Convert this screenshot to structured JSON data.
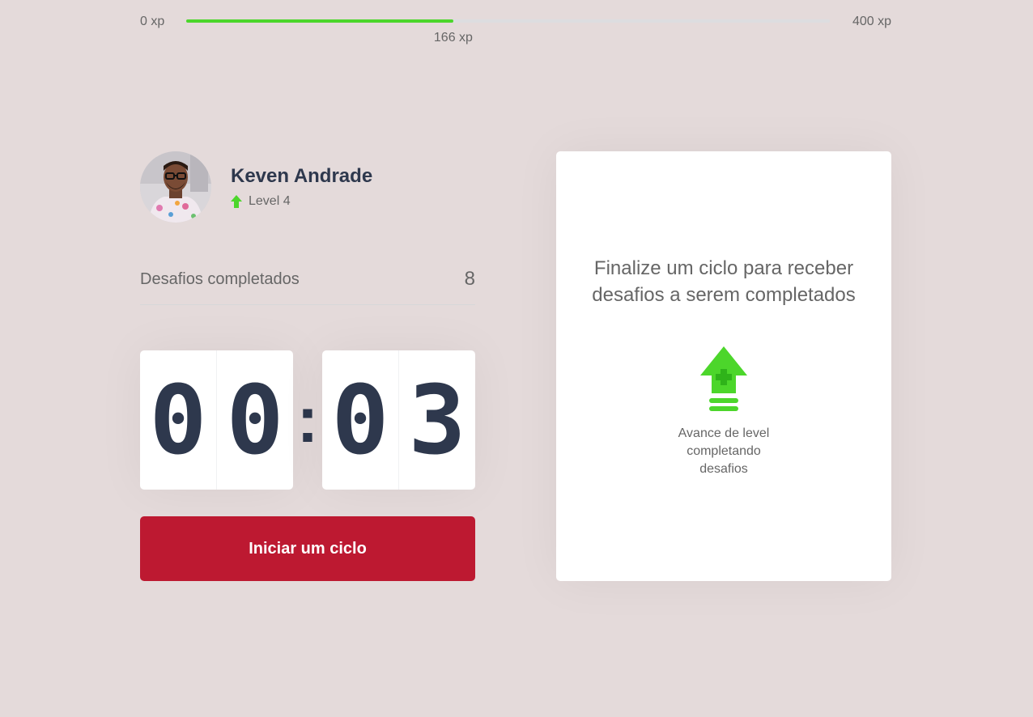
{
  "xp": {
    "min_label": "0 xp",
    "max_label": "400 xp",
    "current_label": "166 xp",
    "current": 166,
    "max": 400,
    "fill_color": "#4cd62b"
  },
  "profile": {
    "name": "Keven Andrade",
    "level_label": "Level 4",
    "level_icon": "level-up-arrow-icon"
  },
  "challenges": {
    "label": "Desafios completados",
    "count": "8"
  },
  "countdown": {
    "minute_tens": "0",
    "minute_ones": "0",
    "separator": ":",
    "second_tens": "0",
    "second_ones": "3"
  },
  "start_button": {
    "label": "Iniciar um ciclo",
    "color": "#bd1931"
  },
  "challenge_card": {
    "title": "Finalize um ciclo para receber desafios a serem completados",
    "icon": "level-up-icon",
    "description": "Avance de level completando desafios"
  }
}
